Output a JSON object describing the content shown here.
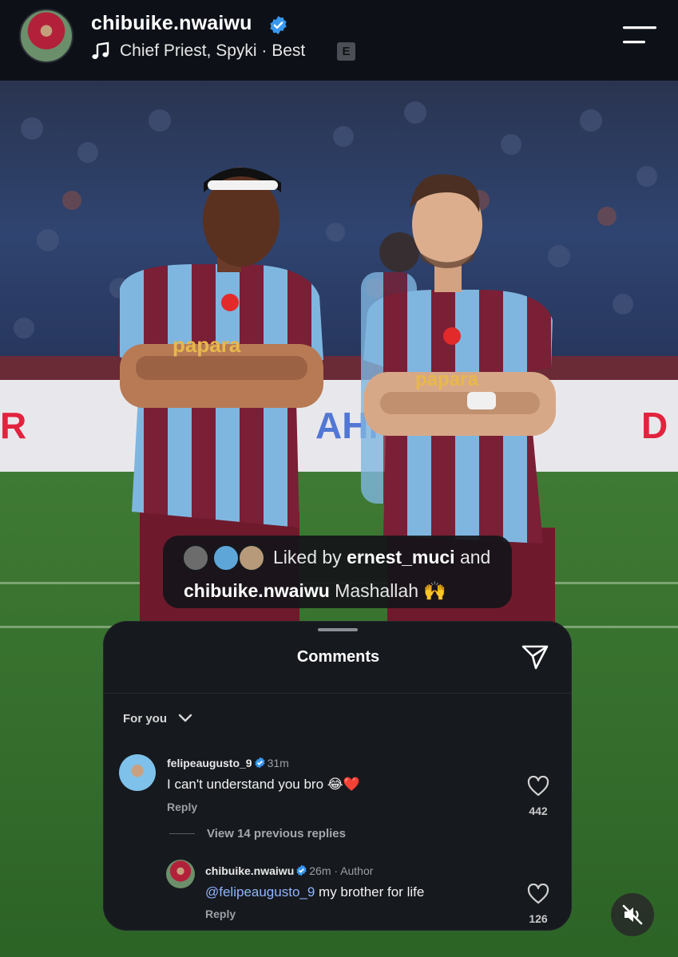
{
  "header": {
    "username": "chibuike.nwaiwu",
    "song": "Chief Priest, Spyki · Best",
    "explicit_badge": "E"
  },
  "post": {
    "photo_description_icon": "post-photo",
    "liked_by_prefix": "Liked by ",
    "liked_by_user": "ernest_muci",
    "liked_by_suffix": " and",
    "caption_user": "chibuike.nwaiwu",
    "caption_text": " Mashallah 🙌"
  },
  "comments_sheet": {
    "title": "Comments",
    "filter_label": "For you",
    "comments": [
      {
        "username": "felipeaugusto_9",
        "time": "31m",
        "text": "I can't understand you bro 😂❤️",
        "reply_label": "Reply",
        "likes": "442"
      }
    ],
    "view_replies": "View 14 previous replies",
    "replies": [
      {
        "username": "chibuike.nwaiwu",
        "time": "26m",
        "author_tag": "Author",
        "mention": "@felipeaugusto_9",
        "text": " my brother for life",
        "reply_label": "Reply",
        "likes": "126"
      }
    ]
  },
  "colors": {
    "header_bg": "#0d1117",
    "verified_blue": "#3897f0",
    "mention_blue": "#8fb5ff",
    "sheet_bg": "#16191e",
    "jersey_maroon": "#7a1f35",
    "jersey_blue": "#7fb6e0"
  }
}
